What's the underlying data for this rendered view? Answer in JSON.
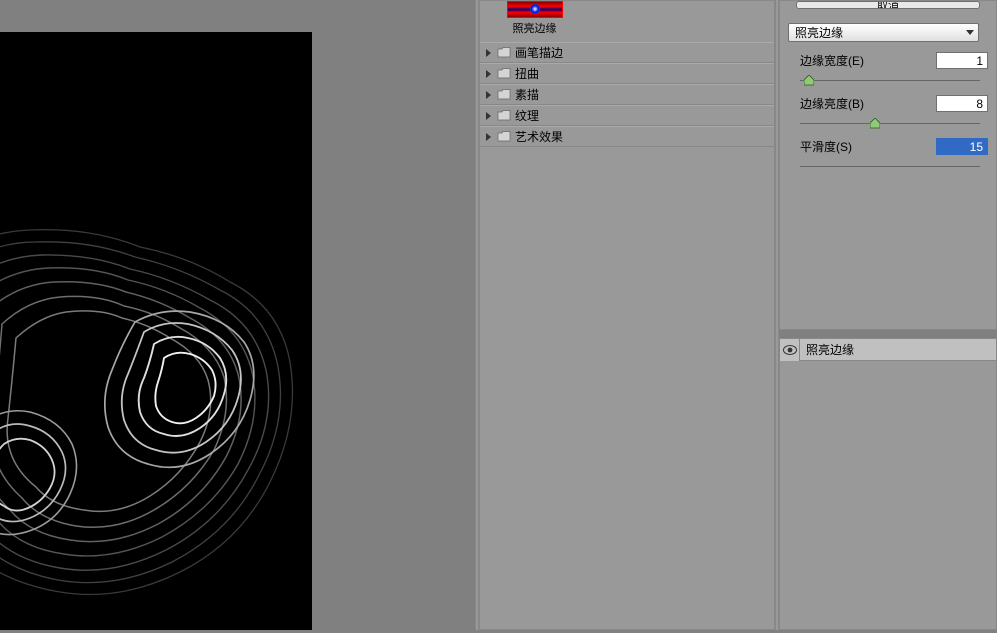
{
  "preview": {
    "selected_filter_label": "照亮边缘"
  },
  "categories": [
    {
      "label": "画笔描边"
    },
    {
      "label": "扭曲"
    },
    {
      "label": "素描"
    },
    {
      "label": "纹理"
    },
    {
      "label": "艺术效果"
    }
  ],
  "controls": {
    "cancel_button_label": "取消",
    "dropdown_selected": "照亮边缘",
    "params": [
      {
        "label": "边缘宽度(E)",
        "value": "1",
        "slider_pct": 2,
        "selected": false,
        "color": "#8fc97a"
      },
      {
        "label": "边缘亮度(B)",
        "value": "8",
        "slider_pct": 39,
        "selected": false,
        "color": "#8fc97a"
      },
      {
        "label": "平滑度(S)",
        "value": "15",
        "slider_pct": 0,
        "selected": true,
        "color": "#8fc97a"
      }
    ]
  },
  "layers": {
    "item_label": "照亮边缘"
  }
}
